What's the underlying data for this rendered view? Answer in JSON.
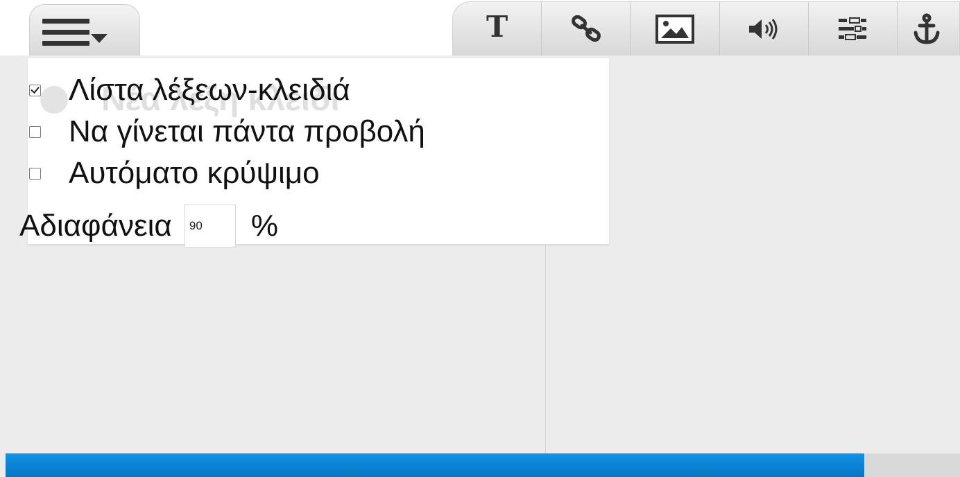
{
  "menu": {
    "button_icon": "hamburger-menu-icon",
    "caret_icon": "caret-down-icon"
  },
  "toolbar": {
    "items": [
      {
        "name": "text-icon",
        "glyph": "T"
      },
      {
        "name": "link-icon"
      },
      {
        "name": "image-icon"
      },
      {
        "name": "audio-icon"
      },
      {
        "name": "list-settings-icon"
      },
      {
        "name": "anchor-icon"
      }
    ]
  },
  "dropdown": {
    "ghost_text": "Νέα λέξη κλειδί",
    "options": [
      {
        "label": "Λίστα λέξεων-κλειδιά",
        "checked": true
      },
      {
        "label": "Να γίνεται πάντα προβολή",
        "checked": false
      },
      {
        "label": "Αυτόματο κρύψιμο",
        "checked": false
      }
    ],
    "opacity": {
      "label": "Αδιαφάνεια",
      "value": "90",
      "unit": "%"
    }
  },
  "progress": {
    "fraction": 0.9,
    "color": "#0a84d6"
  }
}
